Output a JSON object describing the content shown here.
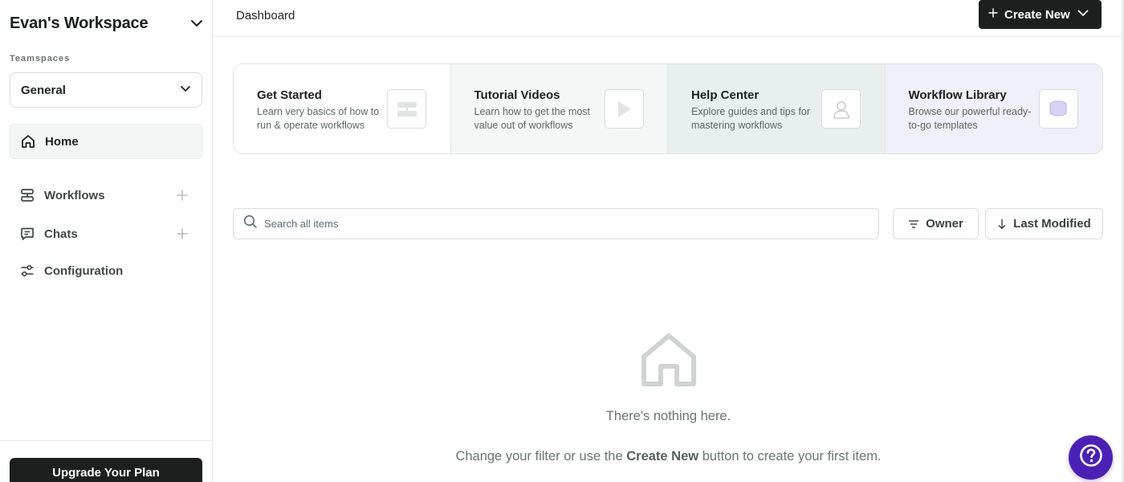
{
  "sidebar": {
    "workspace_title": "Evan's Workspace",
    "teamspaces_label": "Teamspaces",
    "teamspace_selected": "General",
    "items": [
      {
        "label": "Home",
        "icon": "home-icon",
        "active": true
      },
      {
        "label": "Workflows",
        "icon": "workflows-icon",
        "add": true
      },
      {
        "label": "Chats",
        "icon": "chat-icon",
        "add": true
      },
      {
        "label": "Configuration",
        "icon": "sliders-icon"
      }
    ],
    "upgrade_label": "Upgrade Your Plan"
  },
  "header": {
    "title": "Dashboard",
    "create_label": "Create New"
  },
  "cards": [
    {
      "title": "Get Started",
      "desc": "Learn very basics of how to run & operate workflows",
      "icon": "workflow-blocks-icon",
      "bg": "#ffffff"
    },
    {
      "title": "Tutorial Videos",
      "desc": "Learn how to get the most value out of workflows",
      "icon": "play-icon",
      "bg": "#f4f7f6"
    },
    {
      "title": "Help Center",
      "desc": "Explore guides and tips for mastering workflows",
      "icon": "person-icon",
      "bg": "#e9eeee"
    },
    {
      "title": "Workflow Library",
      "desc": "Browse our powerful ready-to-go templates",
      "icon": "stack-icon",
      "bg": "#eff0fa"
    }
  ],
  "search": {
    "placeholder": "Search all items"
  },
  "filters": {
    "owner_label": "Owner",
    "sort_label": "Last Modified"
  },
  "empty_state": {
    "title": "There's nothing here.",
    "sub_before": "Change your filter or use the ",
    "sub_bold": "Create New",
    "sub_after": " button to create your first item."
  },
  "colors": {
    "primary_dark": "#1c1f1e",
    "help_fab": "#4b21b5",
    "border": "#d9dcdb"
  }
}
